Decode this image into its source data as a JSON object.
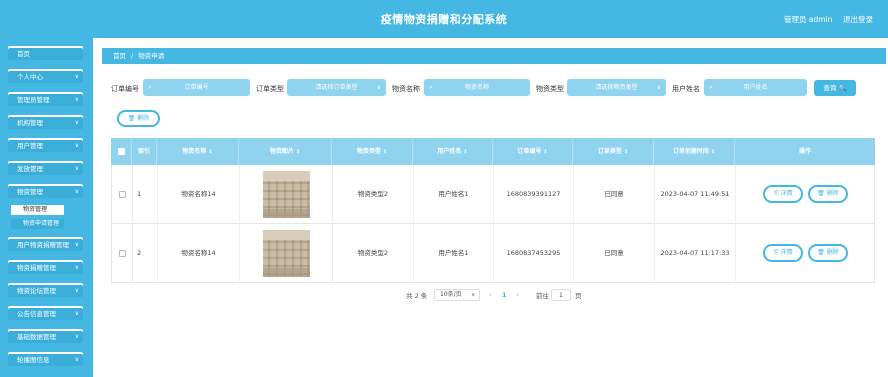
{
  "header": {
    "title": "疫情物资捐赠和分配系统",
    "user": "管理员 admin",
    "logout": "退出登录"
  },
  "sidebar": {
    "items": [
      {
        "label": "首页",
        "chev": ""
      },
      {
        "label": "个人中心",
        "chev": "∨"
      },
      {
        "label": "管理员管理",
        "chev": "∨"
      },
      {
        "label": "机构管理",
        "chev": "∨"
      },
      {
        "label": "用户管理",
        "chev": "∨"
      },
      {
        "label": "发放管理",
        "chev": "∨"
      },
      {
        "label": "物资管理",
        "chev": "∨"
      },
      {
        "label": "用户物资捐赠管理",
        "chev": "∨"
      },
      {
        "label": "物资捐赠管理",
        "chev": "∨"
      },
      {
        "label": "物资论坛管理",
        "chev": "∨"
      },
      {
        "label": "公告信息管理",
        "chev": "∨"
      },
      {
        "label": "基础数据管理",
        "chev": "∨"
      },
      {
        "label": "轮播图信息",
        "chev": "∨"
      }
    ],
    "subitems": [
      "物资管理",
      "物资申请管理"
    ]
  },
  "breadcrumb": {
    "home": "首页",
    "sep": "/",
    "current": "物资申请"
  },
  "filters": {
    "order_no_label": "订单编号",
    "order_no_placeholder": "订单编号",
    "order_type_label": "订单类型",
    "order_type_placeholder": "请选择订单类型",
    "goods_name_label": "物资名称",
    "goods_name_placeholder": "物资名称",
    "goods_type_label": "物资类型",
    "goods_type_placeholder": "请选择物资类型",
    "user_name_label": "用户姓名",
    "user_name_placeholder": "用户姓名",
    "search_label": "查询 🔍"
  },
  "toolbar": {
    "delete_label": "🗑 删除"
  },
  "table": {
    "headers": [
      "索引",
      "物资名称",
      "物资图片",
      "物资类型",
      "用户姓名",
      "订单编号",
      "订单类型",
      "订单创建时间",
      "操作"
    ],
    "rows": [
      {
        "index": "1",
        "name": "物资名称14",
        "type": "物资类型2",
        "user": "用户姓名1",
        "order_no": "1680839391127",
        "order_type": "已同意",
        "time": "2023-04-07 11:49:51"
      },
      {
        "index": "2",
        "name": "物资名称14",
        "type": "物资类型2",
        "user": "用户姓名1",
        "order_no": "1680837453295",
        "order_type": "已同意",
        "time": "2023-04-07 11:17:33"
      }
    ],
    "detail_label": "🗎 详情",
    "delete_label": "🗑 删除"
  },
  "pagination": {
    "total": "共 2 条",
    "page_size": "10条/页",
    "current": "1",
    "goto_label": "前往",
    "goto_value": "1",
    "page_suffix": "页"
  }
}
